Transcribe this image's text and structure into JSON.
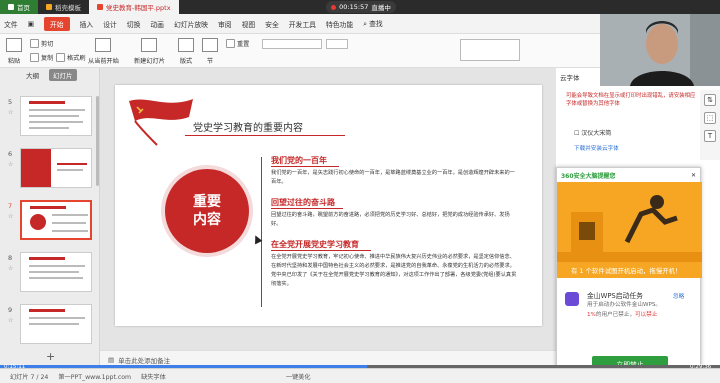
{
  "titlebar": {
    "tabs": [
      {
        "label": "首页",
        "kind": "home"
      },
      {
        "label": "稻壳模板",
        "kind": "normal"
      },
      {
        "label": "党史教育-韩国平.pptx",
        "kind": "active"
      }
    ],
    "live_time": "00:15:57",
    "live_label": "直播中"
  },
  "ribbon": {
    "file_menu": "文件",
    "start_tab": "开始",
    "tabs": [
      "插入",
      "设计",
      "切换",
      "动画",
      "幻灯片放映",
      "审阅",
      "视图",
      "安全",
      "开发工具",
      "特色功能"
    ],
    "search_label": "查找",
    "buttons": {
      "paste": "粘贴",
      "cut": "剪切",
      "copy": "复制",
      "format_painter": "格式刷",
      "from_current": "从当前开始",
      "new_slide": "新建幻灯片",
      "layout": "版式",
      "section": "节",
      "reset": "重置"
    }
  },
  "left_panel": {
    "tab_outline": "大纲",
    "tab_slides": "幻灯片",
    "slides": [
      {
        "num": "5",
        "selected": false,
        "kind": "list"
      },
      {
        "num": "6",
        "selected": false,
        "kind": "cover",
        "text": "第二章 党史学习教育的重要内容"
      },
      {
        "num": "7",
        "selected": true,
        "kind": "circle"
      },
      {
        "num": "8",
        "selected": false,
        "kind": "list"
      },
      {
        "num": "9",
        "selected": false,
        "kind": "list"
      }
    ],
    "add_button": "+"
  },
  "slide": {
    "title": "党史学习教育的重要内容",
    "circle_text": "重要内容",
    "sections": [
      {
        "heading": "我们党的一百年",
        "body": "我们党的一百年，是矢志践行初心使命的一百年，是筚路蓝缕奠基立业的一百年，是创造辉煌开辟未来的一百年。"
      },
      {
        "heading": "回望过往的奋斗路",
        "body": "回望过往的奋斗路，眺望前方的奋进路，必须把党的历史学习好、总结好，把党的成功经验传承好、发扬好。"
      },
      {
        "heading": "在全党开展党史学习教育",
        "body": "在全党开展党史学习教育，牢记初心使命、推进中华民族伟大复兴历史伟业的必然要求，是坚定信仰信念、在新时代坚持和发展中国特色社会主义的必然要求，是推进党的自我革命、永葆党的生机活力的必然要求。党中央已印发了《关于在全党开展党史学习教育的通知》，对这项工作作出了部署，各级党委(党组)要认真贯彻落实。"
      }
    ]
  },
  "notes_placeholder": "单击此处添加备注",
  "statusbar": {
    "slide_counter": "幻灯片 7 / 24",
    "template": "第一PPT_www.1ppt.com",
    "spell": "缺失字体",
    "beautify": "一键美化",
    "time_current": "0:15:11",
    "time_total": "0:29:36",
    "progress": 0.51
  },
  "right_panel": {
    "header": "云字体",
    "note": "可能会导致文档在显示或打印时出现错乱，请安装相应字体或替换为其他字体",
    "font_name": "汉仪大宋简",
    "download_link": "下载并安装云字体"
  },
  "popup": {
    "brand": "360安全大脑提醒您",
    "banner_text": "有 1 个软件试图开机启动，拖慢开机！",
    "app_title": "金山WPS启动任务",
    "app_sub": "用于启动办公软件金山WPS。",
    "stat_pct": "1%",
    "stat_text": "的用户已禁止，",
    "stat_action": "可以禁止",
    "hide_link": "忽略",
    "button": "立即禁止"
  },
  "colors": {
    "accent": "#c62828",
    "ribbon_start": "#e5452e",
    "banner": "#f6a623",
    "popup_button": "#2e9e3e"
  }
}
